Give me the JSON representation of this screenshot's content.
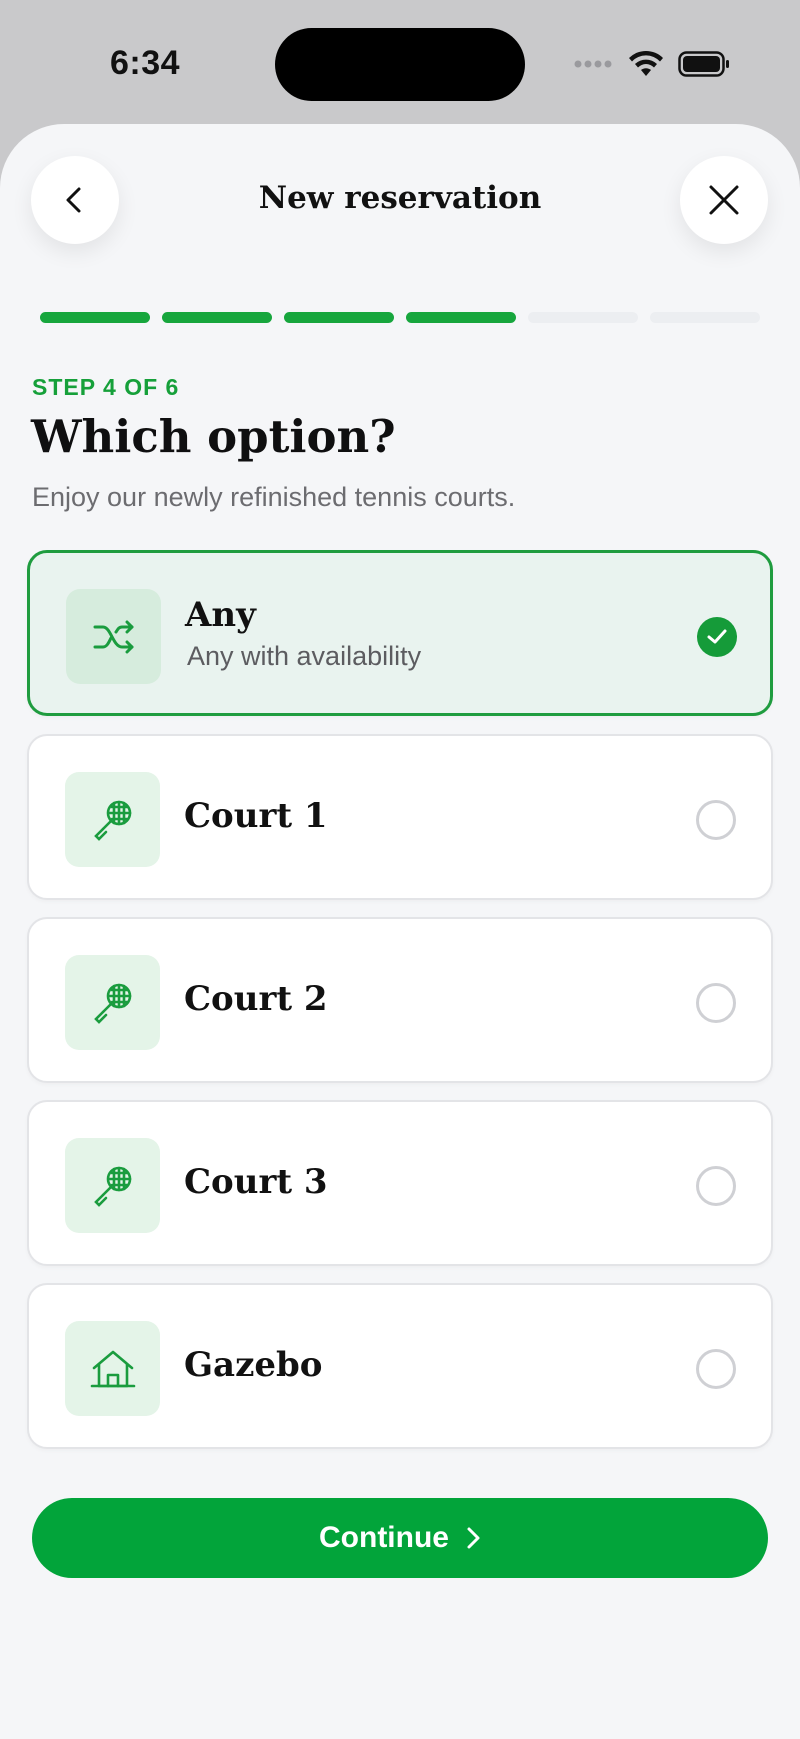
{
  "status_bar": {
    "time": "6:34"
  },
  "header": {
    "title": "New reservation"
  },
  "progress": {
    "current_step": 4,
    "total_steps": 6
  },
  "step_label": "STEP 4 OF 6",
  "heading": "Which option?",
  "subtitle": "Enjoy our newly refinished tennis courts.",
  "options": [
    {
      "name": "Any",
      "subtitle": "Any with availability",
      "icon": "shuffle-icon",
      "selected": true
    },
    {
      "name": "Court 1",
      "icon": "tennis-racket-icon",
      "selected": false
    },
    {
      "name": "Court 2",
      "icon": "tennis-racket-icon",
      "selected": false
    },
    {
      "name": "Court 3",
      "icon": "tennis-racket-icon",
      "selected": false
    },
    {
      "name": "Gazebo",
      "icon": "house-icon",
      "selected": false
    }
  ],
  "continue_label": "Continue",
  "colors": {
    "accent": "#02a43a",
    "accent_light": "#e4f4e8",
    "selected_bg": "#e9f3ef"
  }
}
